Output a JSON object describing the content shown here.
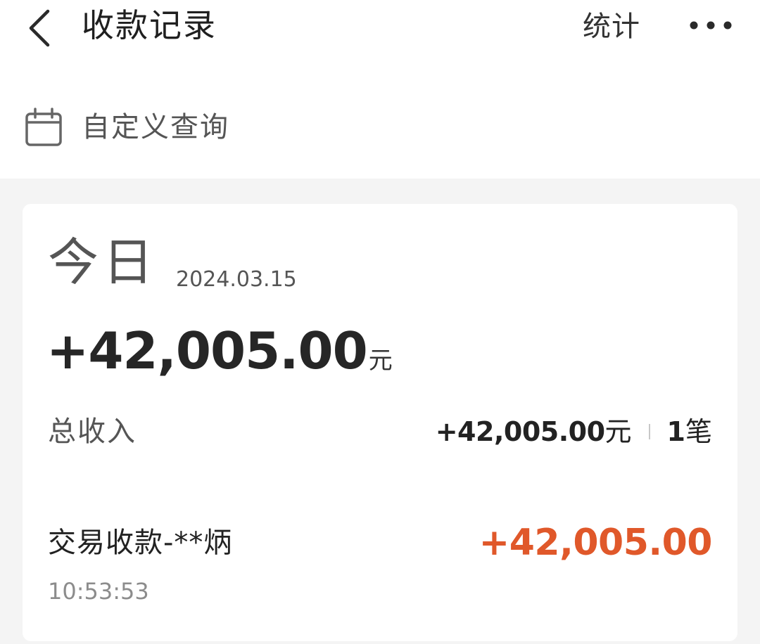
{
  "header": {
    "title": "收款记录",
    "stats_label": "统计",
    "back_icon": "chevron-left-icon",
    "more_icon": "more-horizontal-icon"
  },
  "query": {
    "icon": "calendar-icon",
    "label": "自定义查询"
  },
  "day_summary": {
    "day_label": "今日",
    "date": "2024.03.15",
    "total_amount": "+42,005.00",
    "currency_unit": "元",
    "income_label": "总收入",
    "income_amount": "+42,005.00",
    "income_unit": "元",
    "count": "1",
    "count_unit": "笔"
  },
  "transactions": [
    {
      "name": "交易收款-**炳",
      "time": "10:53:53",
      "amount": "+42,005.00"
    }
  ],
  "colors": {
    "accent_amount": "#e0582a",
    "page_background": "#f4f4f4",
    "card_background": "#ffffff"
  }
}
